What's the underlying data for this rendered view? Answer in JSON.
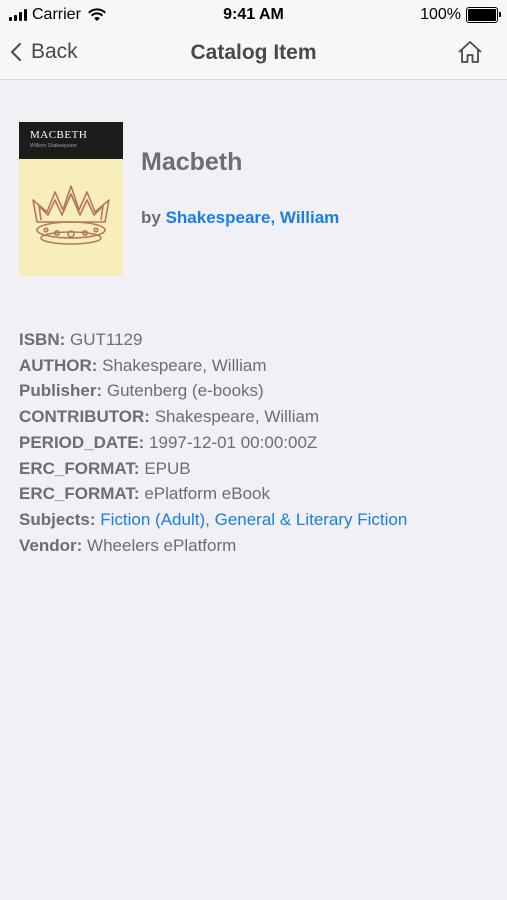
{
  "status_bar": {
    "carrier": "Carrier",
    "time": "9:41 AM",
    "battery": "100%"
  },
  "nav": {
    "back_label": "Back",
    "title": "Catalog Item",
    "home_icon": "home-icon"
  },
  "book": {
    "cover_title": "MACBETH",
    "cover_author": "William Shakespeare",
    "title": "Macbeth",
    "by_label": "by",
    "author_link": "Shakespeare, William"
  },
  "details": {
    "isbn": {
      "label": "ISBN:",
      "value": "GUT1129"
    },
    "author": {
      "label": "AUTHOR:",
      "value": "Shakespeare, William"
    },
    "publisher": {
      "label": "Publisher:",
      "value": "Gutenberg (e-books)"
    },
    "contributor": {
      "label": "CONTRIBUTOR:",
      "value": "Shakespeare, William"
    },
    "period_date": {
      "label": "PERIOD_DATE:",
      "value": "1997-12-01 00:00:00Z"
    },
    "erc_format_1": {
      "label": "ERC_FORMAT:",
      "value": "EPUB"
    },
    "erc_format_2": {
      "label": "ERC_FORMAT:",
      "value": "ePlatform eBook"
    },
    "subjects": {
      "label": "Subjects:",
      "items": [
        "Fiction (Adult)",
        "General & Literary Fiction"
      ],
      "separator": ", "
    },
    "vendor": {
      "label": "Vendor:",
      "value": "Wheelers ePlatform"
    }
  },
  "colors": {
    "link": "#1a7ee8",
    "text": "#6d6d72",
    "background": "#f0f0f5"
  }
}
